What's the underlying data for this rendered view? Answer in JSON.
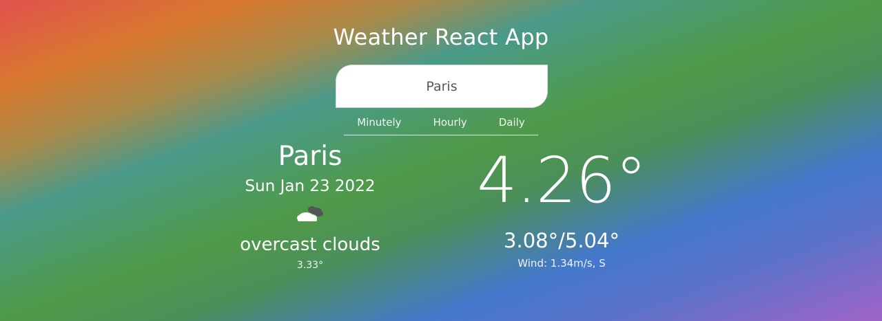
{
  "app": {
    "title": "Weather React App"
  },
  "search": {
    "value": "Paris"
  },
  "tabs": [
    {
      "label": "Minutely"
    },
    {
      "label": "Hourly"
    },
    {
      "label": "Daily"
    }
  ],
  "current": {
    "city": "Paris",
    "date": "Sun Jan 23 2022",
    "icon": "cloud-icon",
    "description": "overcast clouds",
    "feels_like": "3.33°",
    "temperature": "4.26°",
    "min_max": "3.08°/5.04°",
    "wind": "Wind: 1.34m/s, S"
  }
}
